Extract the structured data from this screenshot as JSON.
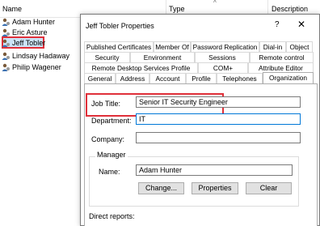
{
  "list": {
    "columns": [
      "Name",
      "Type",
      "Description"
    ],
    "users": [
      "Adam Hunter",
      "Eric Asture",
      "Jeff Tobler",
      "Lindsay Hadaway",
      "Philip Wagener"
    ]
  },
  "dialog": {
    "title": "Jeff Tobler Properties",
    "help": "?",
    "close": "✕",
    "tabs_row1": [
      "Published Certificates",
      "Member Of",
      "Password Replication",
      "Dial-in",
      "Object"
    ],
    "tabs_row2": [
      "Security",
      "Environment",
      "Sessions",
      "Remote control"
    ],
    "tabs_row3": [
      "Remote Desktop Services Profile",
      "COM+",
      "Attribute Editor"
    ],
    "tabs_row4": [
      "General",
      "Address",
      "Account",
      "Profile",
      "Telephones",
      "Organization"
    ],
    "organization": {
      "job_title_label": "Job Title:",
      "job_title_value": "Senior IT Security Engineer",
      "department_label": "Department:",
      "department_value": "IT",
      "company_label": "Company:",
      "company_value": "",
      "manager_group": "Manager",
      "manager_name_label": "Name:",
      "manager_name_value": "Adam Hunter",
      "change_button": "Change...",
      "properties_button": "Properties",
      "clear_button": "Clear",
      "direct_reports_label": "Direct reports:"
    }
  }
}
